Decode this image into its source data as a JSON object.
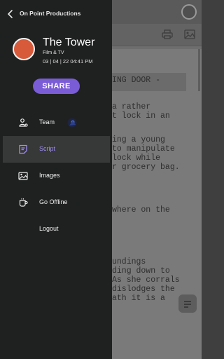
{
  "drawer": {
    "company": "On Point Productions",
    "project": {
      "title": "The Tower",
      "genre": "Film & TV",
      "date": "03 | 04 | 22 04:41 PM",
      "avatar_color": "#d75a3a"
    },
    "share_label": "SHARE",
    "accent_color": "#7a5cd6",
    "menu": [
      {
        "label": "Team",
        "icon": "team-icon"
      },
      {
        "label": "Script",
        "icon": "script-icon",
        "selected": true
      },
      {
        "label": "Images",
        "icon": "images-icon"
      },
      {
        "label": "Go Offline",
        "icon": "offline-icon"
      },
      {
        "label": "Logout"
      }
    ]
  },
  "background_script": {
    "lines": [
      "ING DOOR -",
      "a rather",
      "t lock in an",
      "ing a young",
      "to manipulate",
      "lock while",
      "r grocery bag.",
      "where on the",
      "undings",
      "ding down to",
      "As she corrals",
      "dislodges the",
      "ath it is a"
    ]
  }
}
